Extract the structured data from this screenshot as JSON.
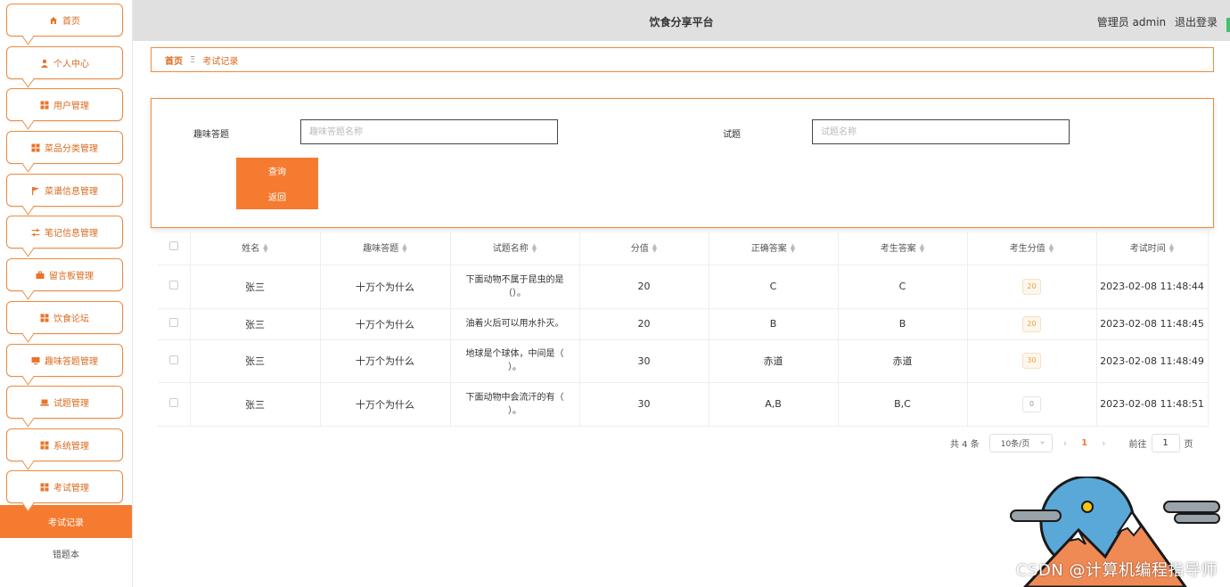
{
  "header": {
    "title": "饮食分享平台",
    "role": "管理员 admin",
    "logout": "退出登录"
  },
  "sidebar": {
    "items": [
      {
        "label": "首页",
        "icon": "home-icon"
      },
      {
        "label": "个人中心",
        "icon": "user-icon"
      },
      {
        "label": "用户管理",
        "icon": "grid-icon"
      },
      {
        "label": "菜品分类管理",
        "icon": "grid-icon"
      },
      {
        "label": "菜谱信息管理",
        "icon": "flag-icon"
      },
      {
        "label": "笔记信息管理",
        "icon": "sliders-icon"
      },
      {
        "label": "留言板管理",
        "icon": "briefcase-icon"
      },
      {
        "label": "饮食论坛",
        "icon": "grid-icon"
      },
      {
        "label": "趣味答题管理",
        "icon": "monitor-icon"
      },
      {
        "label": "试题管理",
        "icon": "laptop-icon"
      },
      {
        "label": "系统管理",
        "icon": "grid-icon"
      },
      {
        "label": "考试管理",
        "icon": "grid-icon"
      }
    ],
    "sub_active": "考试记录",
    "sub_item": "错题本"
  },
  "breadcrumb": {
    "home": "首页",
    "separator": "Ξ",
    "current": "考试记录"
  },
  "search": {
    "quiz_label": "趣味答题",
    "quiz_placeholder": "趣味答题名称",
    "question_label": "试题",
    "question_placeholder": "试题名称",
    "query_button": "查询",
    "back_button": "返回"
  },
  "table": {
    "columns": [
      "姓名",
      "趣味答题",
      "试题名称",
      "分值",
      "正确答案",
      "考生答案",
      "考生分值",
      "考试时间"
    ],
    "rows": [
      {
        "name": "张三",
        "quiz": "十万个为什么",
        "question": "下面动物不属于昆虫的是（）。",
        "score": "20",
        "correct": "C",
        "answer": "C",
        "got": "20",
        "time": "2023-02-08 11:48:44"
      },
      {
        "name": "张三",
        "quiz": "十万个为什么",
        "question": "油着火后可以用水扑灭。",
        "score": "20",
        "correct": "B",
        "answer": "B",
        "got": "20",
        "time": "2023-02-08 11:48:45"
      },
      {
        "name": "张三",
        "quiz": "十万个为什么",
        "question": "地球是个球体，中间是（ ）。",
        "score": "30",
        "correct": "赤道",
        "answer": "赤道",
        "got": "30",
        "time": "2023-02-08 11:48:49"
      },
      {
        "name": "张三",
        "quiz": "十万个为什么",
        "question": "下面动物中会流汗的有（ ）。",
        "score": "30",
        "correct": "A,B",
        "answer": "B,C",
        "got": "0",
        "time": "2023-02-08 11:48:51"
      }
    ]
  },
  "pagination": {
    "total": "共 4 条",
    "page_size": "10条/页",
    "current_page": "1",
    "goto_prefix": "前往",
    "goto_value": "1",
    "goto_suffix": "页"
  },
  "watermark": "CSDN @计算机编程指导师",
  "colors": {
    "accent": "#f47b30",
    "border": "#f08a3c",
    "header_bg": "#e0e0e0"
  }
}
